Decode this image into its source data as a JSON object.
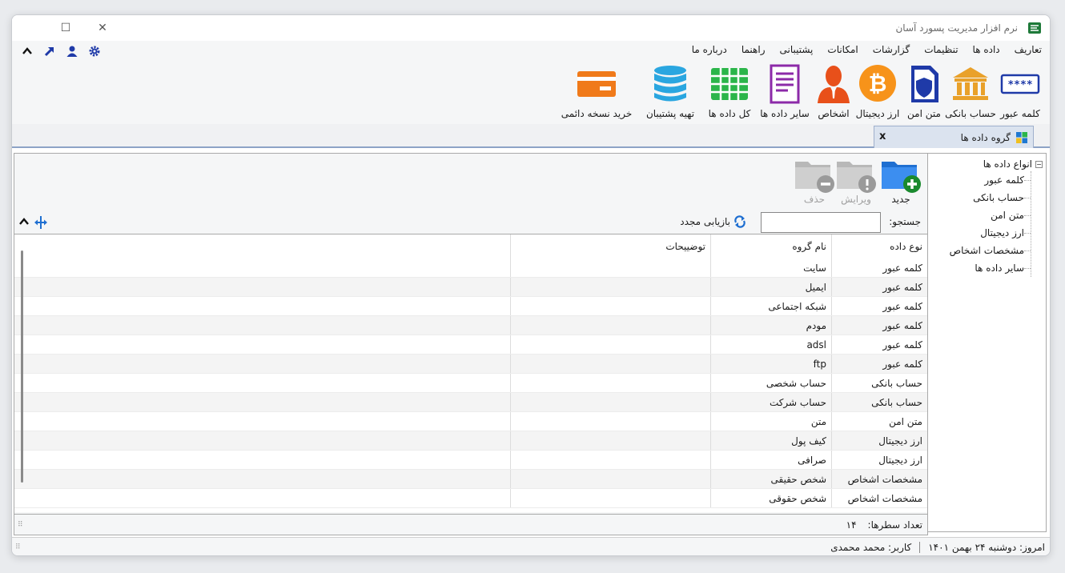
{
  "window": {
    "title": "نرم افزار مدیریت پسورد آسان",
    "minimize_label": "—",
    "maximize_label": "☐",
    "close_label": "✕"
  },
  "menu": {
    "items": [
      "تعاریف",
      "داده ها",
      "تنظیمات",
      "گزارشات",
      "امکانات",
      "پشتیبانی",
      "راهنما",
      "درباره ما"
    ]
  },
  "quick_icons": [
    "gear-icon",
    "user-icon",
    "arrow-upright-icon",
    "chevron-up-icon"
  ],
  "ribbon": {
    "buttons": [
      {
        "label": "کلمه عبور",
        "icon": "password-icon"
      },
      {
        "label": "حساب بانکی",
        "icon": "bank-icon"
      },
      {
        "label": "متن امن",
        "icon": "secure-doc-icon"
      },
      {
        "label": "ارز دیجیتال",
        "icon": "bitcoin-icon"
      },
      {
        "label": "اشخاص",
        "icon": "person-icon"
      },
      {
        "label": "سایر داده ها",
        "icon": "document-icon"
      },
      {
        "label": "کل داده ها",
        "icon": "grid-icon"
      },
      {
        "label": "تهیه پشتیبان",
        "icon": "database-icon"
      },
      {
        "label": "خرید نسخه دائمی",
        "icon": "credit-card-icon"
      }
    ]
  },
  "tab": {
    "label": "گروه داده ها",
    "close_label": "x"
  },
  "tree": {
    "root_label": "انواع داده ها",
    "toggle_label": "−",
    "items": [
      "کلمه عبور",
      "حساب بانکی",
      "متن امن",
      "ارز دیجیتال",
      "مشخصات اشخاص",
      "سایر داده ها"
    ]
  },
  "toolbar": {
    "new_label": "جدید",
    "edit_label": "ویرایش",
    "delete_label": "حذف"
  },
  "search": {
    "label": "جستجو:",
    "value": "",
    "refresh_label": "بازیابی مجدد"
  },
  "grid": {
    "headers": {
      "type": "نوع داده",
      "name": "نام گروه",
      "desc": "توضییحات"
    },
    "rows": [
      {
        "type": "کلمه عبور",
        "name": "سایت",
        "desc": ""
      },
      {
        "type": "کلمه عبور",
        "name": "ایمیل",
        "desc": ""
      },
      {
        "type": "کلمه عبور",
        "name": "شبکه اجتماعی",
        "desc": ""
      },
      {
        "type": "کلمه عبور",
        "name": "مودم",
        "desc": ""
      },
      {
        "type": "کلمه عبور",
        "name": "adsl",
        "desc": ""
      },
      {
        "type": "کلمه عبور",
        "name": "ftp",
        "desc": ""
      },
      {
        "type": "حساب بانکی",
        "name": "حساب شخصی",
        "desc": ""
      },
      {
        "type": "حساب بانکی",
        "name": "حساب شرکت",
        "desc": ""
      },
      {
        "type": "متن امن",
        "name": "متن",
        "desc": ""
      },
      {
        "type": "ارز دیجیتال",
        "name": "کیف پول",
        "desc": ""
      },
      {
        "type": "ارز دیجیتال",
        "name": "صرافی",
        "desc": ""
      },
      {
        "type": "مشخصات اشخاص",
        "name": "شخص حقیقی",
        "desc": ""
      },
      {
        "type": "مشخصات اشخاص",
        "name": "شخص حقوقی",
        "desc": ""
      }
    ]
  },
  "footer": {
    "row_count_label": "تعداد سطرها:",
    "row_count_value": "۱۴"
  },
  "status": {
    "date_text": "امروز: دوشنبه ۲۴ بهمن ۱۴۰۱",
    "user_text": "کاربر: محمد محمدی"
  },
  "colors": {
    "accent_blue": "#1f3aa8",
    "ribbon_gold": "#e9a12a",
    "bitcoin_orange": "#f7931a",
    "person_orange": "#e8501a",
    "doc_purple": "#8c2aa8",
    "grid_green": "#2bb54a",
    "database_blue": "#2aa6e0",
    "card_orange": "#f07a1a"
  }
}
